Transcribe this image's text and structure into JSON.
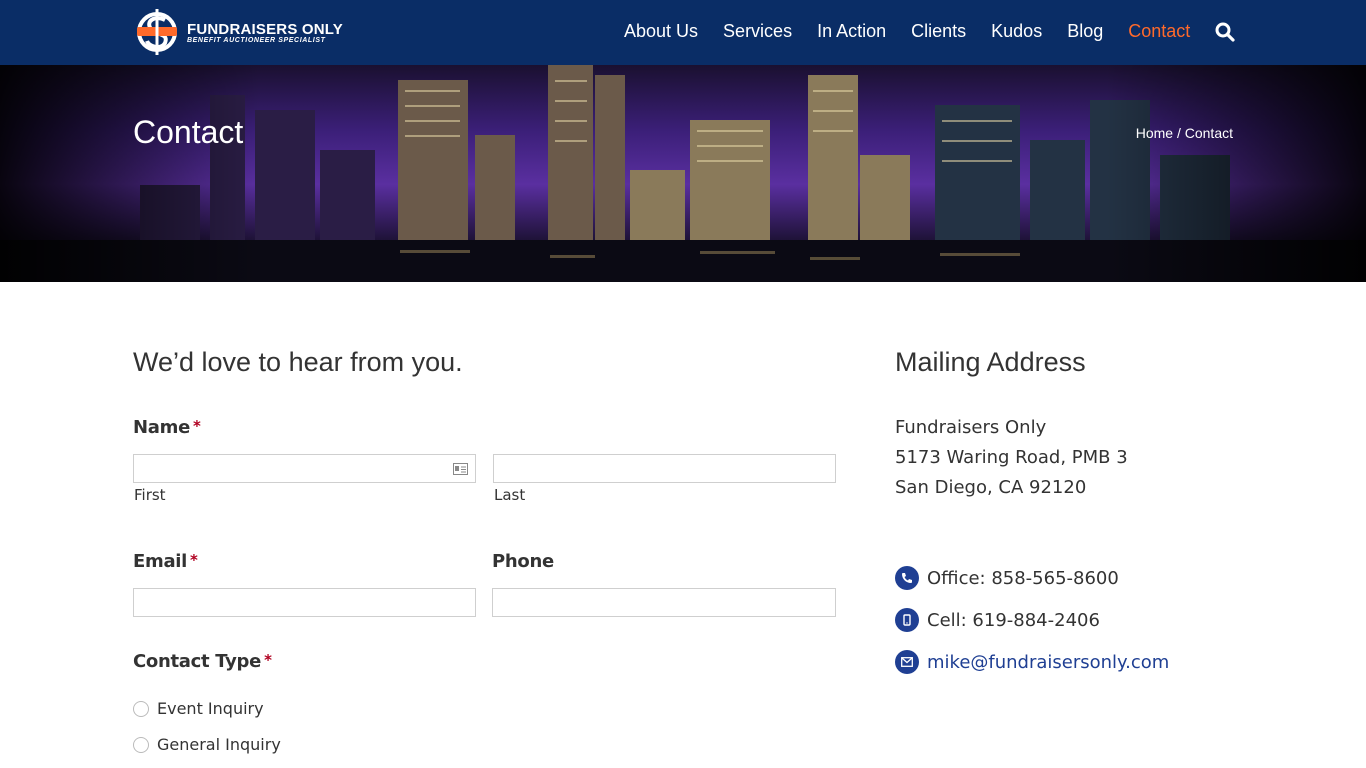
{
  "header": {
    "logo_text": "FUNDRAISERS ONLY",
    "logo_subtext": "BENEFIT AUCTIONEER SPECIALIST",
    "nav": [
      {
        "label": "About Us"
      },
      {
        "label": "Services"
      },
      {
        "label": "In Action"
      },
      {
        "label": "Clients"
      },
      {
        "label": "Kudos"
      },
      {
        "label": "Blog"
      },
      {
        "label": "Contact",
        "active": true
      }
    ],
    "search_icon": "search-icon"
  },
  "hero": {
    "title": "Contact",
    "breadcrumb": "Home / Contact"
  },
  "form": {
    "heading": "We’d love to hear from you.",
    "name_label": "Name",
    "required_mark": "*",
    "first_label": "First",
    "last_label": "Last",
    "email_label": "Email",
    "phone_label": "Phone",
    "contact_type_label": "Contact Type",
    "options": [
      "Event Inquiry",
      "General Inquiry"
    ]
  },
  "sidebar": {
    "heading": "Mailing Address",
    "address": [
      "Fundraisers Only",
      "5173 Waring Road, PMB 3",
      "San Diego, CA 92120"
    ],
    "office": "Office: 858-565-8600",
    "cell": "Cell: 619-884-2406",
    "email": "mike@fundraisersonly.com"
  },
  "colors": {
    "header_bg": "#0a2d66",
    "accent_orange": "#ff6a2b",
    "icon_blue": "#1f3f93",
    "required_red": "#b00020"
  }
}
